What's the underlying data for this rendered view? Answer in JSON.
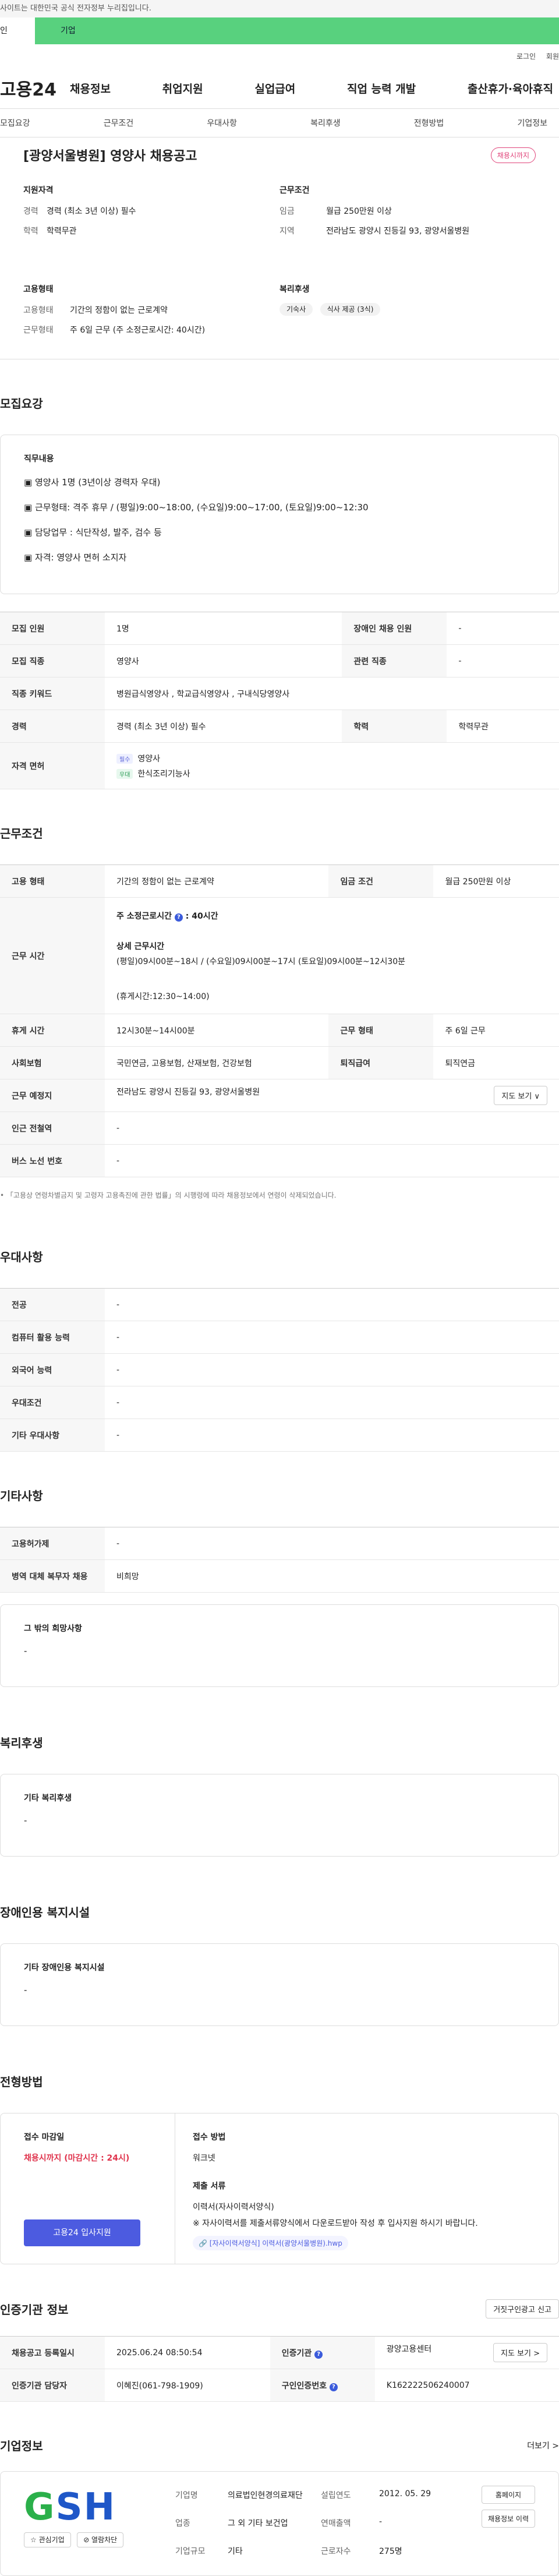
{
  "topbar": {
    "notice": "사이트는 대한민국 공식 전자정부 누리집입니다."
  },
  "site_tabs": {
    "personal": "인",
    "company": "기업"
  },
  "util": {
    "login": "로그인",
    "join": "회원"
  },
  "gnb": {
    "logo": "고용24",
    "menu": [
      "채용정보",
      "취업지원",
      "실업급여",
      "직업 능력 개발",
      "출산휴가·육아휴직"
    ]
  },
  "subnav": [
    "모집요강",
    "근무조건",
    "우대사항",
    "복리후생",
    "전형방법",
    "기업정보"
  ],
  "header": {
    "title": "[광양서울병원] 영양사 채용공고",
    "status": "채용시까지"
  },
  "summary": {
    "qual_title": "지원자격",
    "career_label": "경력",
    "career": "경력 (최소 3년 이상) 필수",
    "edu_label": "학력",
    "edu": "학력무관",
    "cond_title": "근무조건",
    "wage_label": "임금",
    "wage": "월급 250만원 이상",
    "region_label": "지역",
    "region": "전라남도 광양시 진등길 93, 광양서울병원",
    "emp_title": "고용형태",
    "emptype_label": "고용형태",
    "emptype": "기간의 정함이 없는 근로계약",
    "worktype_label": "근무형태",
    "worktype": "주 6일 근무 (주 소정근로시간: 40시간)",
    "welfare_title": "복리후생",
    "welfare_chips": [
      "기숙사",
      "식사 제공 (3식)"
    ]
  },
  "recruit": {
    "heading": "모집요강",
    "duty_title": "직무내용",
    "duty_lines": [
      "▣ 영양사  1명 (3년이상 경력자 우대)",
      "▣ 근무형태: 격주 휴무 / (평일)9:00~18:00, (수요일)9:00~17:00, (토요일)9:00~12:30",
      "▣ 담당업무 : 식단작성, 발주, 검수 등",
      "▣ 자격: 영양사 면허 소지자"
    ],
    "rows": {
      "count_label": "모집 인원",
      "count": "1명",
      "disabled_label": "장애인 채용 인원",
      "disabled": "-",
      "job_label": "모집 직종",
      "job": "영양사",
      "related_label": "관련 직종",
      "related": "-",
      "keyword_label": "직종 키워드",
      "keyword": "병원급식영양사 , 학교급식영양사 , 구내식당영양사",
      "career_label": "경력",
      "career": "경력 (최소 3년 이상) 필수",
      "edu_label": "학력",
      "edu": "학력무관",
      "license_label": "자격 면허",
      "license_req_tag": "필수",
      "license_req": "영양사",
      "license_pref_tag": "우대",
      "license_pref": "한식조리기능사"
    }
  },
  "work": {
    "heading": "근무조건",
    "emptype_label": "고용 형태",
    "emptype": "기간의 정함이 없는 근로계약",
    "wage_label": "임금 조건",
    "wage": "월급 250만원 이상",
    "hours_label": "근무 시간",
    "weekly_label": "주 소정근로시간",
    "weekly": ": 40시간",
    "detail_label": "상세 근무시간",
    "detail": "(평일)09시00분~18시 / (수요일)09시00분~17시 (토요일)09시00분~12시30분",
    "break_note": "(휴게시간:12:30~14:00)",
    "rest_label": "휴게 시간",
    "rest": "12시30분~14시00분",
    "form_label": "근무 형태",
    "form": "주 6일 근무",
    "insurance_label": "사회보험",
    "insurance": "국민연금, 고용보험, 산재보험, 건강보험",
    "severance_label": "퇴직급여",
    "severance": "퇴직연금",
    "place_label": "근무 예정지",
    "place": "전라남도 광양시 진등길 93, 광양서울병원",
    "map_btn": "지도 보기 ∨",
    "subway_label": "인근 전철역",
    "subway": "-",
    "bus_label": "버스 노선 번호",
    "bus": "-",
    "note": "「고용상 연령차별금지 및 고령자 고용촉진에 관한 법률」의 시행령에 따라 채용정보에서 연령이 삭제되었습니다."
  },
  "pref": {
    "heading": "우대사항",
    "rows": [
      {
        "label": "전공",
        "value": "-"
      },
      {
        "label": "컴퓨터 활용 능력",
        "value": "-"
      },
      {
        "label": "외국어 능력",
        "value": "-"
      },
      {
        "label": "우대조건",
        "value": "-"
      },
      {
        "label": "기타 우대사항",
        "value": "-"
      }
    ]
  },
  "etc": {
    "heading": "기타사항",
    "permit_label": "고용허가제",
    "permit": "-",
    "military_label": "병역 대체 복무자 채용",
    "military": "비희망",
    "other_title": "그 밖의 희망사항",
    "other": "-"
  },
  "welfare": {
    "heading": "복리후생",
    "title": "기타 복리후생",
    "value": "-"
  },
  "facility": {
    "heading": "장애인용 복지시설",
    "title": "기타 장애인용 복지시설",
    "value": "-"
  },
  "process": {
    "heading": "전형방법",
    "deadline_title": "접수 마감일",
    "deadline": "채용시까지 (마감시간 : 24시)",
    "apply_btn": "고용24 입사지원",
    "method_title": "접수 방법",
    "method": "워크넷",
    "docs_title": "제출 서류",
    "docs_1": "이력서(자사이력서양식)",
    "docs_2": "※ 자사이력서를 제출서류양식에서 다운로드받아 작성 후 입사지원 하시기 바랍니다.",
    "docs_link": "[자사이력서양식] 이력서(광양서울병원).hwp"
  },
  "cert": {
    "heading": "인증기관 정보",
    "report_btn": "거짓구인광고 신고",
    "reg_label": "채용공고 등록일시",
    "reg": "2025.06.24 08:50:54",
    "agency_label": "인증기관",
    "agency": "광양고용센터",
    "map_btn": "지도 보기 >",
    "manager_label": "인증기관 담당자",
    "manager": "이혜진(061-798-1909)",
    "number_label": "구인인증번호",
    "number": "K162222506240007"
  },
  "company": {
    "heading": "기업정보",
    "more": "더보기 >",
    "logo_g": "G",
    "logo_rest": "SH",
    "interest_btn": "☆ 관심기업",
    "block_btn": "⊘ 열람차단",
    "name_label": "기업명",
    "name": "의료법인현경의료재단",
    "industry_label": "업종",
    "industry": "그 외 기타 보건업",
    "size_label": "기업규모",
    "size": "기타",
    "founded_label": "설립연도",
    "founded": "2012. 05. 29",
    "sales_label": "연매출액",
    "sales": "-",
    "staff_label": "근로자수",
    "staff": "275명",
    "homepage_btn": "홈페이지",
    "jobs_btn": "채용정보 이력"
  }
}
